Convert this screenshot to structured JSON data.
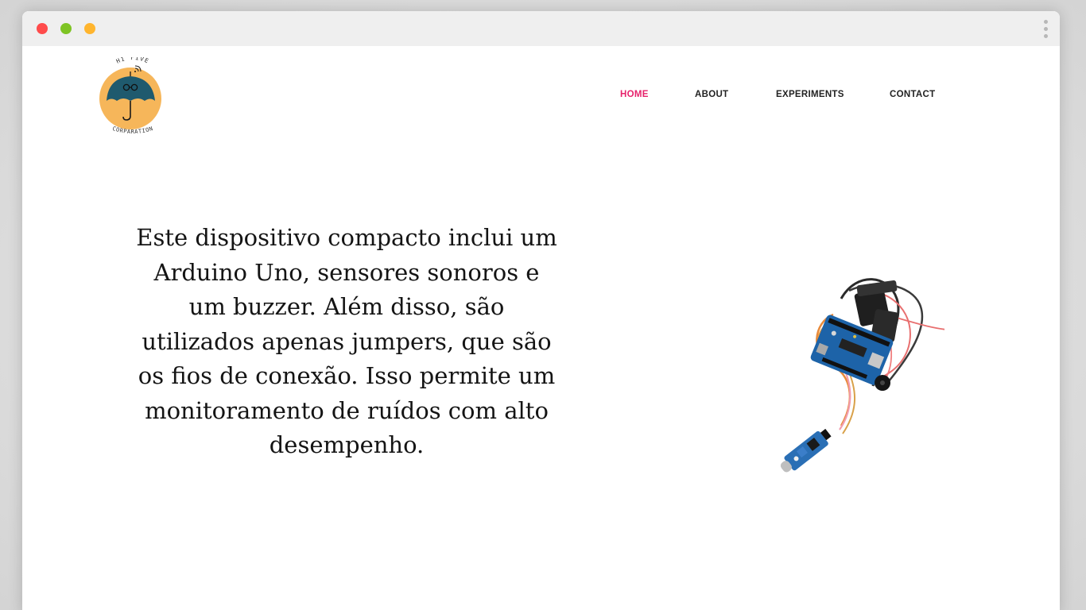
{
  "window": {
    "controls": [
      "close",
      "minimize",
      "maximize"
    ],
    "menu_icon": "vertical-dots-icon"
  },
  "logo": {
    "top_text": "HI FIVE",
    "bottom_text": "CORPARATION",
    "colors": {
      "circle": "#f6b65a",
      "umbrella": "#1f5a6e",
      "handle": "#1a1a1a"
    }
  },
  "nav": {
    "items": [
      {
        "label": "HOME",
        "active": true
      },
      {
        "label": "ABOUT",
        "active": false
      },
      {
        "label": "EXPERIMENTS",
        "active": false
      },
      {
        "label": "CONTACT",
        "active": false
      }
    ],
    "active_color": "#e6226b"
  },
  "hero": {
    "text": "Este dispositivo compacto inclui um Arduino Uno, sensores sonoros e um buzzer. Além disso, são utilizados apenas jumpers, que são os fios de conexão. Isso permite um monitoramento de ruídos com alto desempenho."
  },
  "image": {
    "subject": "arduino-uno-with-sound-sensor-and-buzzer"
  }
}
